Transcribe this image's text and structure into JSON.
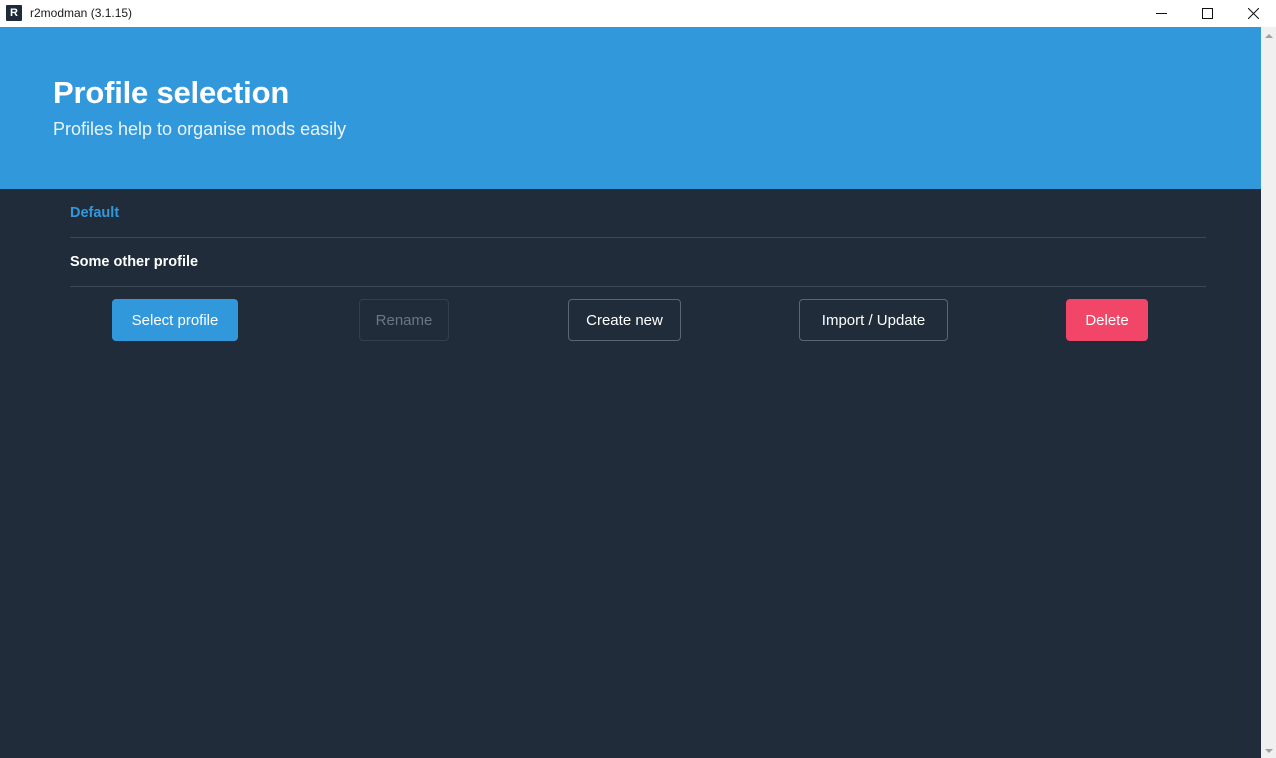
{
  "window": {
    "title": "r2modman (3.1.15)",
    "icon_letter": "R",
    "controls": {
      "minimize": "minimize-icon",
      "maximize": "maximize-icon",
      "close": "close-icon"
    }
  },
  "hero": {
    "title": "Profile selection",
    "subtitle": "Profiles help to organise mods easily",
    "background_color": "#3298dc"
  },
  "profiles": [
    {
      "name": "Default",
      "selected": true
    },
    {
      "name": "Some other profile",
      "selected": false
    }
  ],
  "actions": [
    {
      "label": "Select profile",
      "style": "primary",
      "enabled": true
    },
    {
      "label": "Rename",
      "style": "disabled",
      "enabled": false
    },
    {
      "label": "Create new",
      "style": "outline",
      "enabled": true
    },
    {
      "label": "Import / Update",
      "style": "outline",
      "enabled": true
    },
    {
      "label": "Delete",
      "style": "danger",
      "enabled": true
    }
  ],
  "colors": {
    "accent": "#3298dc",
    "background": "#212c3b",
    "danger": "#f14668",
    "divider": "#3b4a5a",
    "text_muted": "#6b7684"
  },
  "scrollbar": {
    "up_arrow": "scroll-up-icon",
    "down_arrow": "scroll-down-icon"
  }
}
